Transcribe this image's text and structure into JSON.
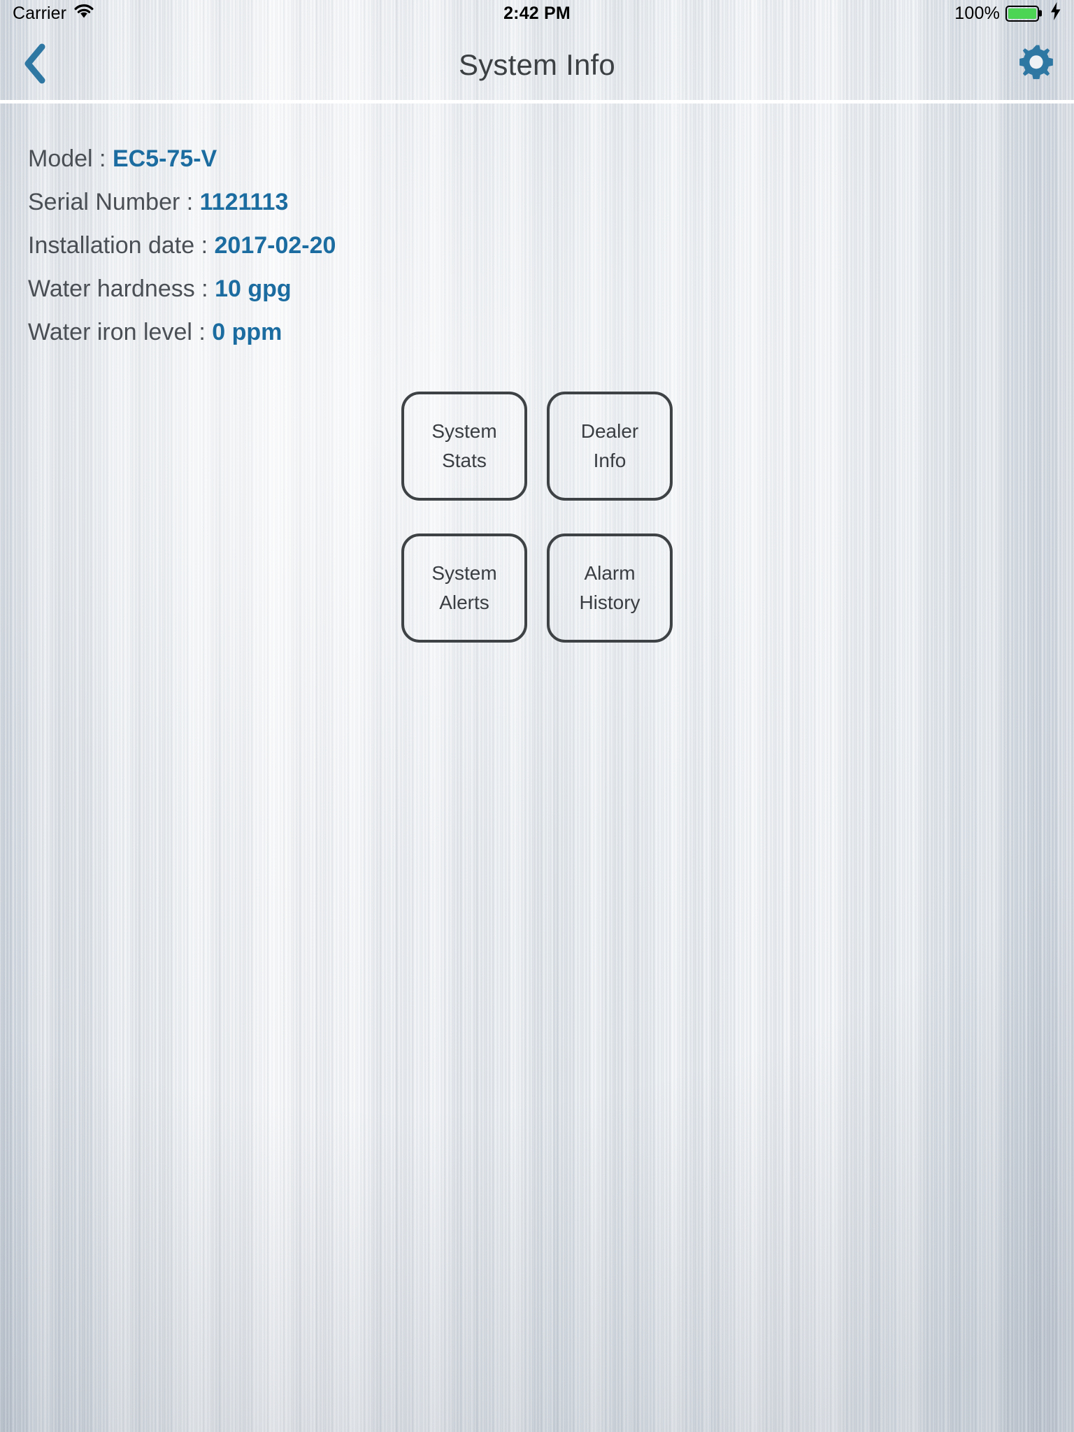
{
  "status_bar": {
    "carrier": "Carrier",
    "wifi_icon": "wifi-icon",
    "time": "2:42 PM",
    "battery_percent": "100%",
    "battery_level": 100,
    "battery_color": "#4CD454",
    "charging_icon": "lightning-bolt-icon"
  },
  "nav_bar": {
    "back_icon": "chevron-left-icon",
    "title": "System Info",
    "settings_icon": "gear-icon",
    "accent_color": "#2E77A3"
  },
  "system_info": {
    "rows": [
      {
        "label": "Model : ",
        "value": "EC5-75-V"
      },
      {
        "label": "Serial Number : ",
        "value": "1121113"
      },
      {
        "label": "Installation date : ",
        "value": "2017-02-20"
      },
      {
        "label": "Water hardness : ",
        "value": "10 gpg"
      },
      {
        "label": "Water iron level : ",
        "value": "0 ppm"
      }
    ],
    "value_color": "#1B6CA0",
    "label_color": "#4a4f55"
  },
  "buttons": [
    {
      "line1": "System",
      "line2": "Stats"
    },
    {
      "line1": "Dealer",
      "line2": "Info"
    },
    {
      "line1": "System",
      "line2": "Alerts"
    },
    {
      "line1": "Alarm",
      "line2": "History"
    }
  ]
}
